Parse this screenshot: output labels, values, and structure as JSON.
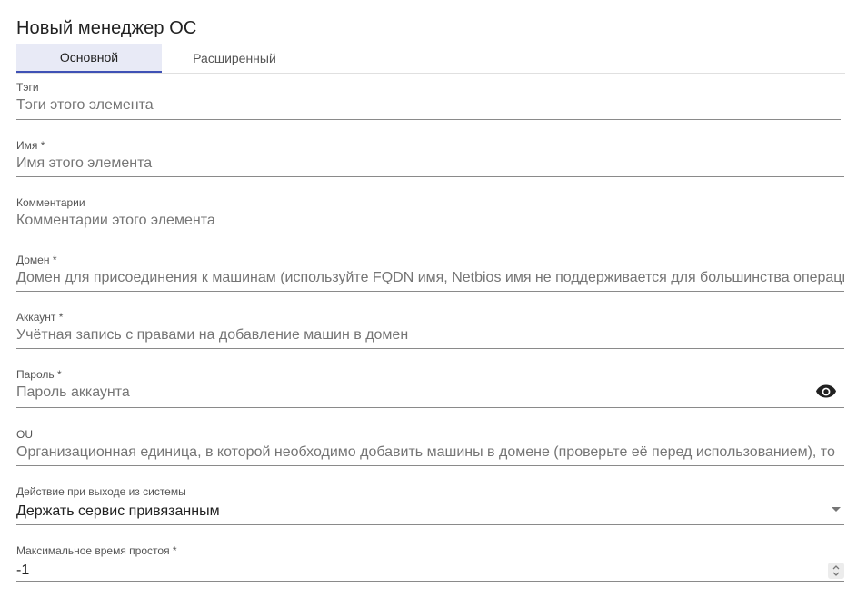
{
  "dialog": {
    "title": "Новый менеджер ОС"
  },
  "tabs": [
    {
      "label": "Основной",
      "active": true
    },
    {
      "label": "Расширенный",
      "active": false
    }
  ],
  "fields": {
    "tags": {
      "label": "Тэги",
      "placeholder": "Тэги этого элемента",
      "value": ""
    },
    "name": {
      "label": "Имя *",
      "placeholder": "Имя этого элемента",
      "value": ""
    },
    "comments": {
      "label": "Комментарии",
      "placeholder": "Комментарии этого элемента",
      "value": ""
    },
    "domain": {
      "label": "Домен *",
      "placeholder": "Домен для присоединения к машинам (используйте FQDN имя, Netbios имя не поддерживается для большинства операций)",
      "value": ""
    },
    "account": {
      "label": "Аккаунт *",
      "placeholder": "Учётная запись с правами на добавление машин в домен",
      "value": ""
    },
    "password": {
      "label": "Пароль *",
      "placeholder": "Пароль аккаунта",
      "value": "",
      "icon": "eye-icon"
    },
    "ou": {
      "label": "OU",
      "placeholder": "Организационная единица, в которой необходимо добавить машины в домене (проверьте её перед использованием), то",
      "value": ""
    },
    "logout_action": {
      "label": "Действие при выходе из системы",
      "value": "Держать сервис привязанным"
    },
    "max_idle": {
      "label": "Максимальное время простоя *",
      "value": "-1"
    }
  },
  "colors": {
    "accent": "#3f51b5",
    "active_tab_bg": "#e8eaf6",
    "placeholder": "#a8a8a8",
    "underline": "#8a8a8a"
  }
}
